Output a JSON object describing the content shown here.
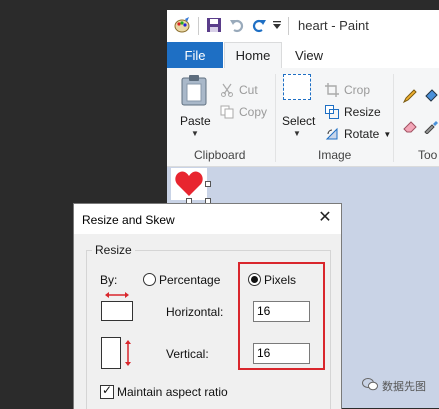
{
  "window": {
    "title": "heart - Paint"
  },
  "ribbon": {
    "tabs": {
      "file": "File",
      "home": "Home",
      "view": "View"
    },
    "clipboard": {
      "paste": "Paste",
      "cut": "Cut",
      "copy": "Copy",
      "label": "Clipboard"
    },
    "image": {
      "select": "Select",
      "crop": "Crop",
      "resize": "Resize",
      "rotate": "Rotate",
      "label": "Image"
    },
    "tools": {
      "label": "Too"
    }
  },
  "dialog": {
    "title": "Resize and Skew",
    "resize": {
      "legend": "Resize",
      "by_label": "By:",
      "percentage_label": "Percentage",
      "pixels_label": "Pixels",
      "selected_unit": "Pixels",
      "horizontal_label": "Horizontal:",
      "horizontal_value": "16",
      "vertical_label": "Vertical:",
      "vertical_value": "16",
      "maintain_label": "Maintain aspect ratio",
      "maintain_checked": true
    }
  },
  "watermark": {
    "text": "数据先图"
  },
  "colors": {
    "accent": "#1e6fc4",
    "highlight": "#d9262c",
    "heart": "#e8252f",
    "canvas_bg": "#c9d3e6"
  }
}
